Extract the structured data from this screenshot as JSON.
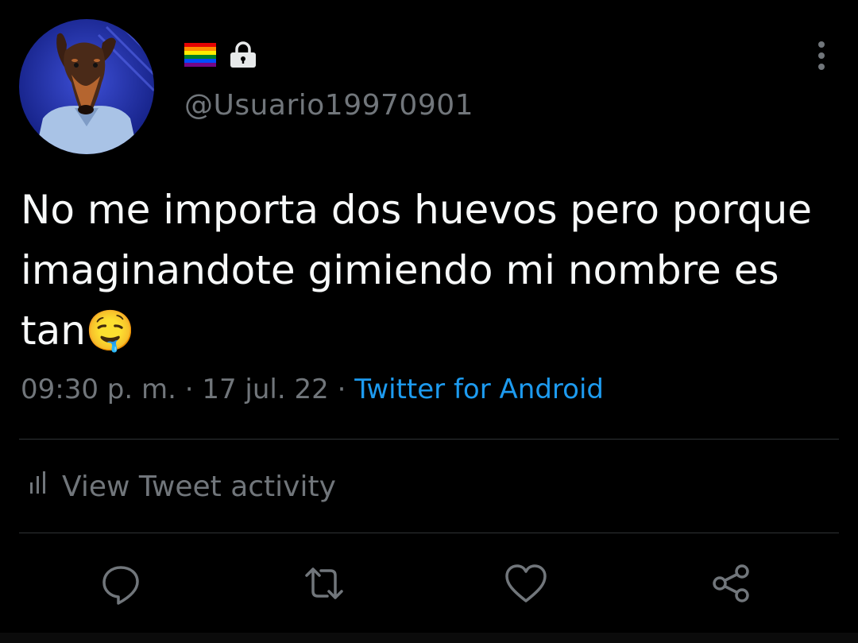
{
  "author": {
    "handle": "@Usuario19970901",
    "avatar_icon": "doberman-dog-avatar",
    "badges": [
      "rainbow-flag-icon",
      "lock-icon"
    ]
  },
  "tweet": {
    "text": "No me importa dos huevos pero porque imaginandote gimiendo mi nombre es tan🤤",
    "time": "09:30 p. m.",
    "separator": "·",
    "date": "17 jul. 22",
    "source": "Twitter for Android"
  },
  "activity": {
    "label": "View Tweet activity"
  },
  "actions": [
    "reply-icon",
    "retweet-icon",
    "like-icon",
    "share-icon"
  ],
  "colors": {
    "background": "#000000",
    "text": "#f7f9f9",
    "secondary": "#71767b",
    "link": "#1d9bf0",
    "divider": "#2f3336"
  }
}
